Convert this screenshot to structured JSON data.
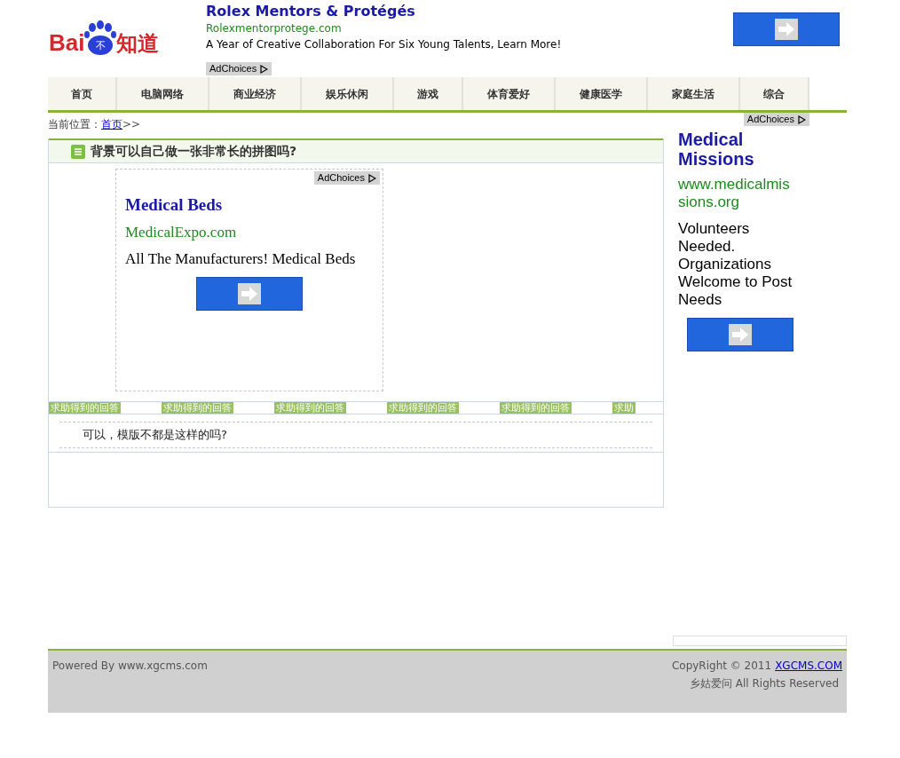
{
  "logo": {
    "latin": "Bai",
    "badge": "不",
    "chinese": "知道"
  },
  "top_ad": {
    "title": "Rolex Mentors & Protégés",
    "url": "Rolexmentorprotege.com",
    "text": "A Year of Creative Collaboration For Six Young Talents, Learn More!",
    "adchoices": "AdChoices"
  },
  "nav": [
    "首页",
    "电脑网络",
    "商业经济",
    "娱乐休闲",
    "游戏",
    "体育爱好",
    "健康医学",
    "家庭生活",
    "综合"
  ],
  "breadcrumb": {
    "label": "当前位置：",
    "link": "首页",
    "sep": ">>"
  },
  "question": {
    "title": "背景可以自己做一张非常长的拼图吗?"
  },
  "inner_ad": {
    "adchoices": "AdChoices",
    "title": "Medical Beds",
    "url": "MedicalExpo.com",
    "text": "All The Manufacturers! Medical Beds"
  },
  "answer_tabs": [
    "求助得到的回答",
    "求助得到的回答",
    "求助得到的回答",
    "求助得到的回答",
    "求助得到的回答",
    "求助"
  ],
  "answer": "可以，模版不都是这样的吗?",
  "side_ad": {
    "adchoices": "AdChoices",
    "title": "Medical Missions",
    "url": "www.medicalmissions.org",
    "text": "Volunteers Needed. Organizations Welcome to Post Needs"
  },
  "footer": {
    "powered": "Powered By www.xgcms.com",
    "copyright": "CopyRight © 2011",
    "link": "XGCMS.COM",
    "rights": "乡姑爱问 All Rights Reserved"
  }
}
